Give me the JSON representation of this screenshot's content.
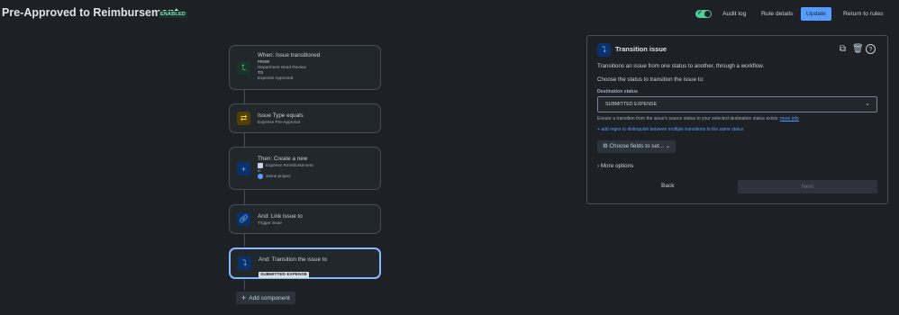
{
  "header": {
    "title": "Pre-Approved to Reimbursement",
    "badge": "ENABLED",
    "audit_log": "Audit log",
    "rule_details": "Rule details",
    "update": "Update",
    "return": "Return to rules",
    "toggle_enabled": true
  },
  "flow": {
    "trigger": {
      "title": "When: Issue transitioned",
      "from_label": "FROM",
      "from_value": "Department Head Review",
      "to_label": "TO",
      "to_value": "Expense Approved"
    },
    "condition": {
      "title": "Issue Type equals",
      "value": "Expense Pre-Approval"
    },
    "create": {
      "title": "Then: Create a new",
      "issue_type": "Expense Reimbursement",
      "in_label": "in",
      "project": "Same project"
    },
    "link": {
      "title": "And: Link issue to",
      "value": "Trigger issue"
    },
    "transition": {
      "title": "And: Transition the issue to",
      "status": "SUBMITTED EXPENSE"
    },
    "add_component": "Add component"
  },
  "panel": {
    "title": "Transition issue",
    "description": "Transitions an issue from one status to another, through a workflow.",
    "instruction": "Choose the status to transition the issue to:",
    "destination_label": "Destination status",
    "destination_value": "SUBMITTED EXPENSE",
    "helper_text": "Ensure a transition from the issue's source status to your selected destination status exists;",
    "helper_link": "more info",
    "regex_link": "+ add regex to distinguish between multiple transitions to the same status",
    "choose_fields": "Choose fields to set...",
    "more_options": "More options",
    "back": "Back",
    "next": "Next"
  },
  "colors": {
    "accent": "#579dff",
    "selected_border": "#85b8ff",
    "enabled_green": "#4bce97",
    "background": "#1d2125"
  }
}
